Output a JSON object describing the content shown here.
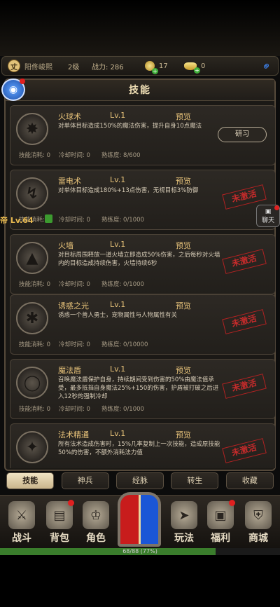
{
  "status": {
    "avatar_char": "丈",
    "name": "阳佟峻熙",
    "level": "2级",
    "power": "战力: 286",
    "currency1": "17",
    "currency2": "0"
  },
  "panel": {
    "title": "技能"
  },
  "skills": [
    {
      "name": "火球术",
      "level": "Lv.1",
      "preview": "预览",
      "desc": "对单体目标造成150%的魔法伤害，提升自身10点魔法",
      "cost": "技能消耗: 0",
      "cooldown": "冷却时间: 0",
      "proficiency": "熟练度: 8/600",
      "action": "研习"
    },
    {
      "name": "雷电术",
      "level": "Lv.1",
      "preview": "预览",
      "desc": "对单体目标造成180%+13点伤害，无视目标3%防御",
      "cost": "技能消耗: 0",
      "cooldown": "冷却时间: 0",
      "proficiency": "熟练度: 0/1000",
      "stamp": "未激活"
    },
    {
      "name": "火墙",
      "level": "Lv.1",
      "preview": "预览",
      "desc": "对目标周围释放一道火墙立即造成50%伤害，之后每秒对火墙内的目标造成持续伤害，火墙持续6秒",
      "cost": "技能消耗: 0",
      "cooldown": "冷却时间: 0",
      "proficiency": "熟练度: 0/1000",
      "stamp": "未激活"
    },
    {
      "name": "诱惑之光",
      "level": "Lv.1",
      "preview": "预览",
      "desc": "诱惑一个兽人勇士，宠物属性与人物属性有关",
      "cost": "技能消耗: 0",
      "cooldown": "冷却时间: 0",
      "proficiency": "熟练度: 0/10000",
      "stamp": "未激活"
    },
    {
      "name": "魔法盾",
      "level": "Lv.1",
      "preview": "预览",
      "desc": "召唤魔法盾保护自身，持续期间受到伤害的50%由魔法值承受，最多抵挡自身魔法25%+150的伤害，护盾被打破之后进入12秒的强制冷却",
      "cost": "技能消耗: 0",
      "cooldown": "冷却时间: 0",
      "proficiency": "熟练度: 0/1000",
      "stamp": "未激活"
    },
    {
      "name": "法术精通",
      "level": "Lv.1",
      "preview": "预览",
      "desc": "所有法术造成伤害时，15%几率复制上一次技能，造成原技能50%的伤害，不额外消耗法力值",
      "stamp": "未激活"
    }
  ],
  "floating": {
    "label": "帝 Lv.64",
    "chat": "聊天"
  },
  "tabs": [
    "技能",
    "神兵",
    "经脉",
    "转生",
    "收藏"
  ],
  "nav": [
    "战斗",
    "背包",
    "角色",
    "玩法",
    "福利",
    "商城"
  ],
  "xp": {
    "text": "68/88 (77%)",
    "ratio": 0.77
  },
  "colors": {
    "accent": "#e8c37a",
    "stamp": "#c42b2b",
    "xp_green": "#3a7d2c"
  }
}
